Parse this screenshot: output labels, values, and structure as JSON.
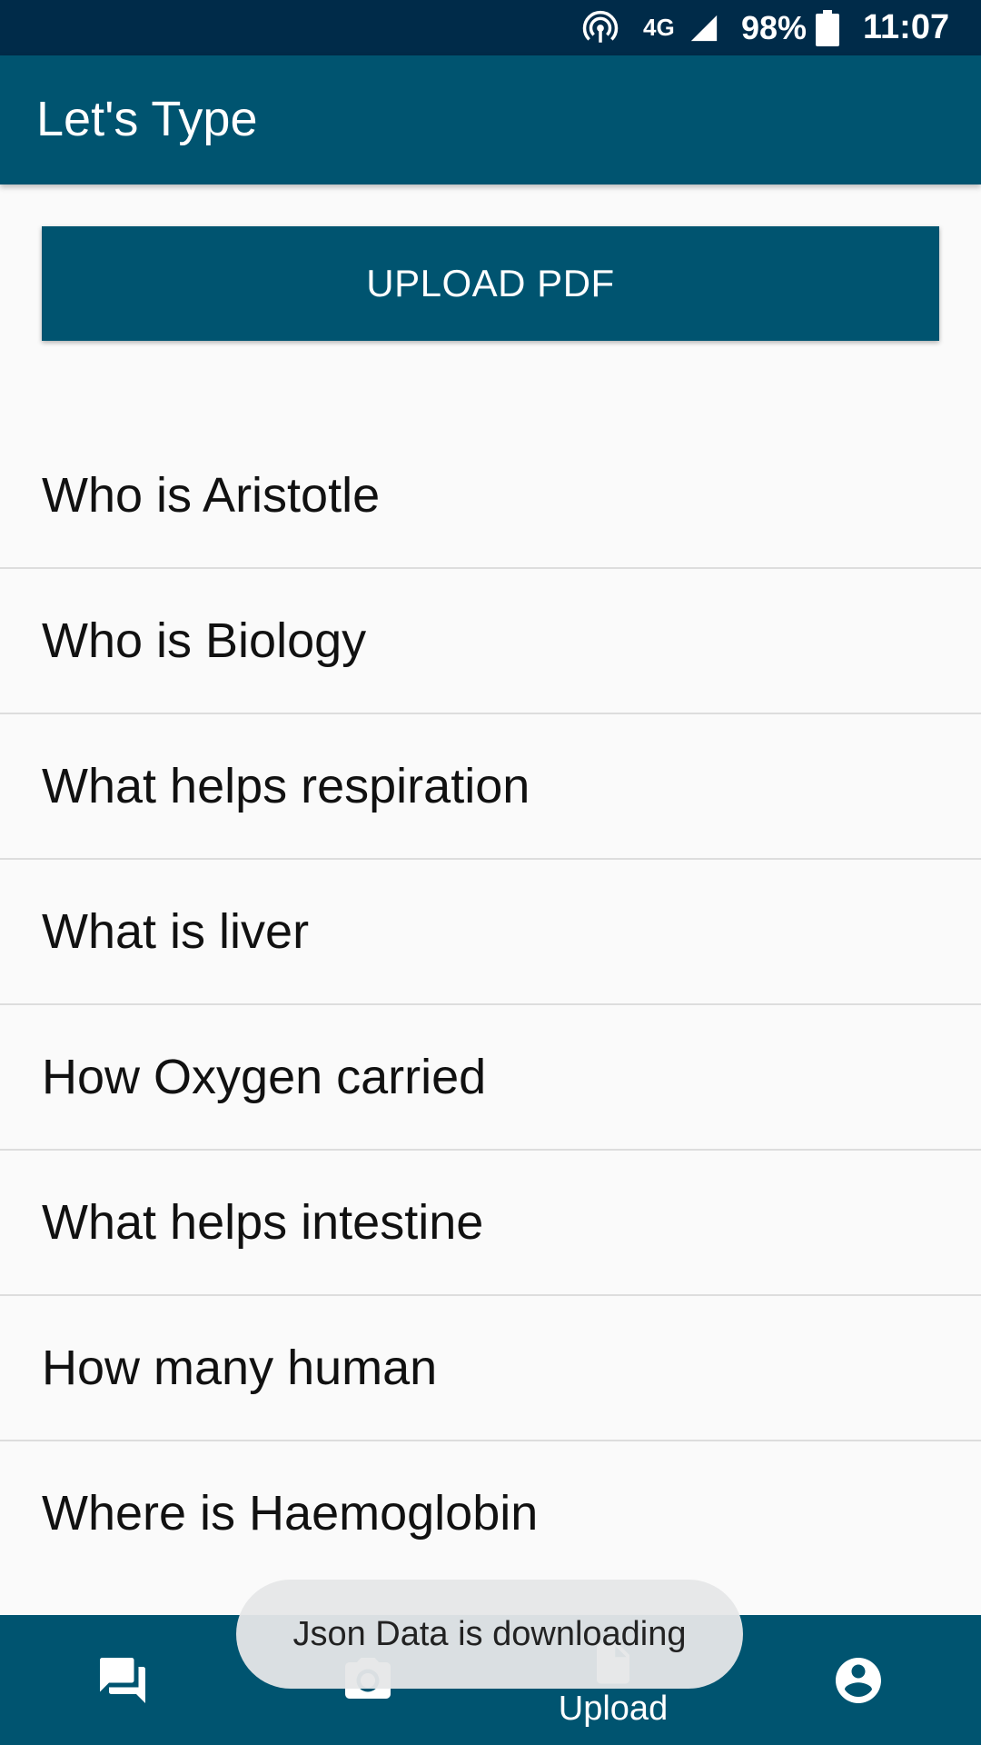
{
  "status_bar": {
    "network": "4G",
    "battery": "98%",
    "time": "11:07",
    "icons": [
      "hotspot-icon",
      "signal-icon",
      "battery-icon"
    ]
  },
  "app_bar": {
    "title": "Let's Type"
  },
  "upload_button": {
    "label": "UPLOAD PDF"
  },
  "questions": [
    "Who is Aristotle",
    "Who is Biology",
    "What helps respiration",
    "What is liver",
    "How Oxygen carried",
    "What helps intestine",
    "How many human",
    "Where is Haemoglobin"
  ],
  "bottom_nav": {
    "items": [
      {
        "icon": "chat-icon",
        "label": ""
      },
      {
        "icon": "camera-icon",
        "label": ""
      },
      {
        "icon": "file-icon",
        "label": "Upload"
      },
      {
        "icon": "account-icon",
        "label": ""
      }
    ]
  },
  "toast": {
    "message": "Json Data is downloading"
  },
  "colors": {
    "status_bar": "#002B49",
    "primary": "#005470",
    "background": "#FAFAFA",
    "divider": "#DDDDDD"
  }
}
